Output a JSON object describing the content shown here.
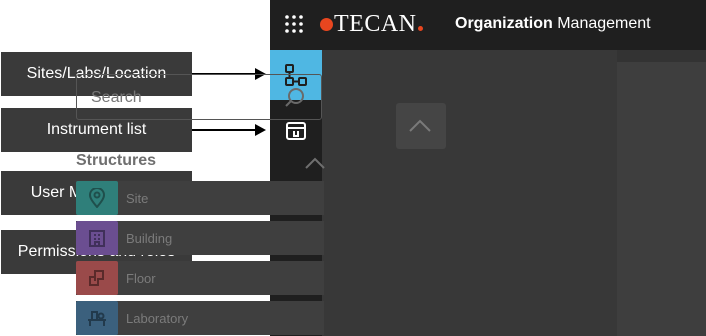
{
  "callouts": [
    {
      "label": "Sites/Labs/Location"
    },
    {
      "label": "Instrument list"
    },
    {
      "label": "User Management"
    },
    {
      "label": "Permissions and roles"
    }
  ],
  "app": {
    "brand": "TECAN",
    "title_bold": "Organization",
    "title_rest": " Management",
    "search_placeholder": "Search",
    "structures_label": "Structures",
    "structures": [
      {
        "label": "Site",
        "icon": "location-pin-icon",
        "color": "#2f7f7a"
      },
      {
        "label": "Building",
        "icon": "building-icon",
        "color": "#6b4e91"
      },
      {
        "label": "Floor",
        "icon": "floor-plan-icon",
        "color": "#9a4a4a"
      },
      {
        "label": "Laboratory",
        "icon": "lab-bench-icon",
        "color": "#3b607d"
      }
    ]
  },
  "colors": {
    "accent": "#4fb7e3",
    "brand_red": "#e8461f",
    "callout_bg": "#3a3a3a"
  }
}
